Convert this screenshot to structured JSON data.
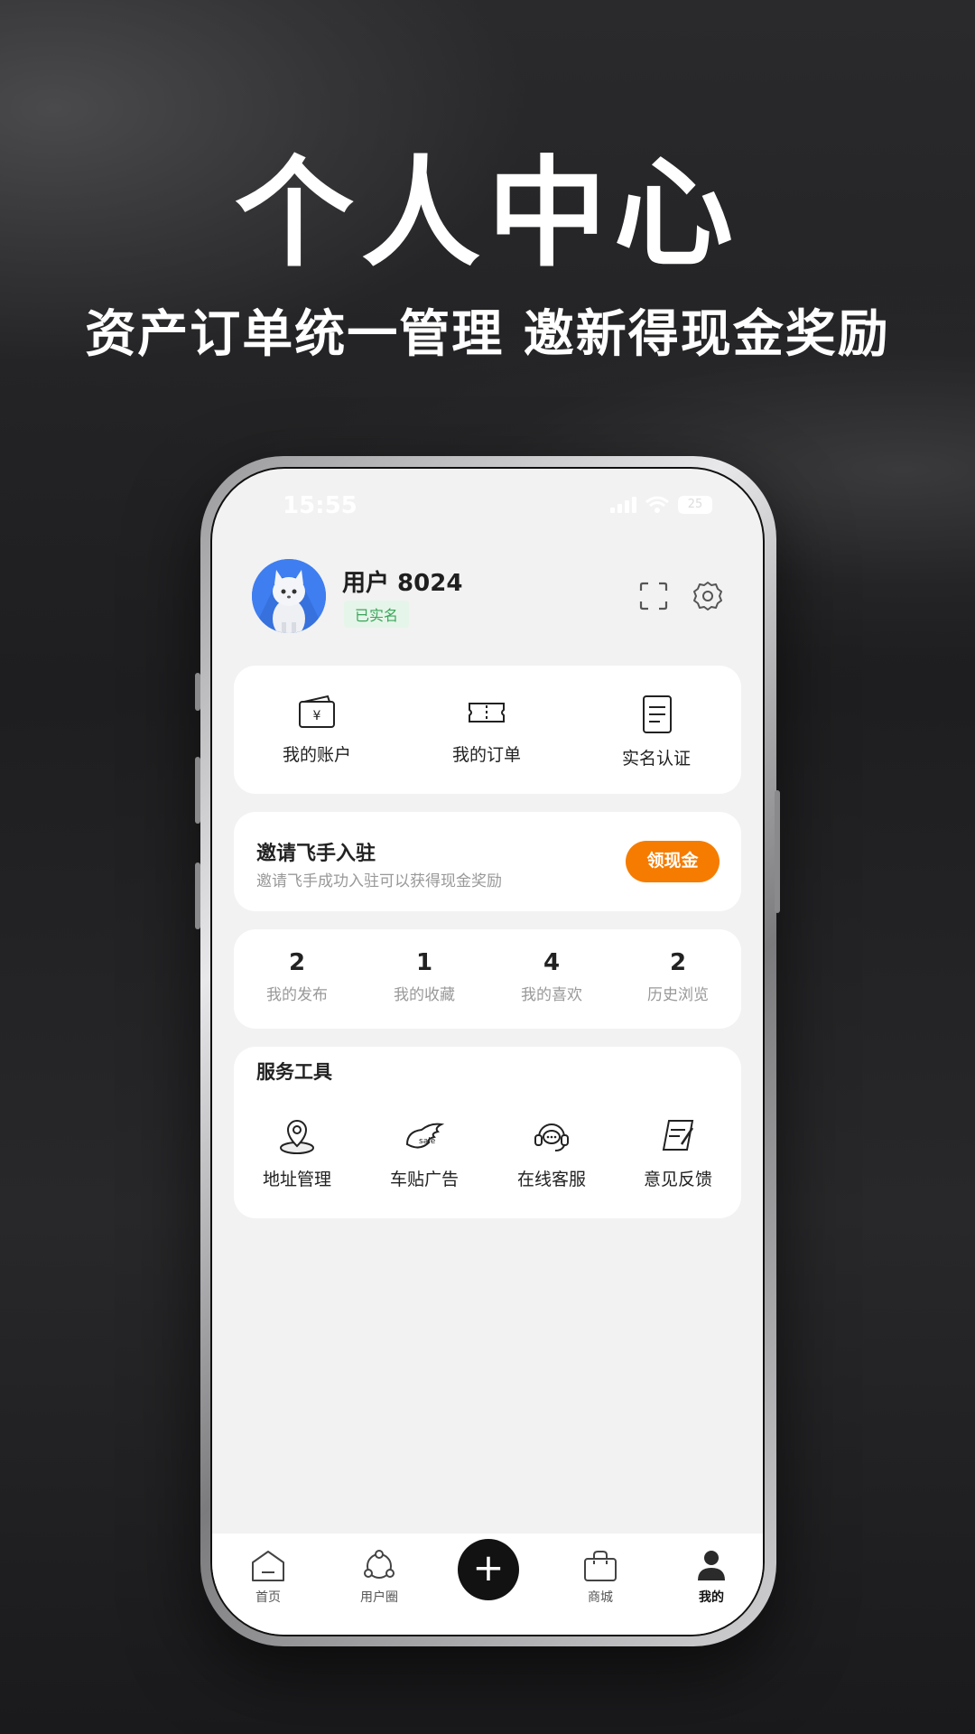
{
  "headline": "个人中心",
  "subheadline": "资产订单统一管理  邀新得现金奖励",
  "status_bar": {
    "time": "15:55",
    "battery": "25"
  },
  "profile": {
    "username": "用户 8024",
    "verified_badge": "已实名"
  },
  "quick_actions": [
    {
      "label": "我的账户",
      "icon": "wallet-icon"
    },
    {
      "label": "我的订单",
      "icon": "ticket-icon"
    },
    {
      "label": "实名认证",
      "icon": "document-icon"
    }
  ],
  "invite": {
    "title": "邀请飞手入驻",
    "description": "邀请飞手成功入驻可以获得现金奖励",
    "button": "领现金"
  },
  "stats": [
    {
      "value": "2",
      "label": "我的发布"
    },
    {
      "value": "1",
      "label": "我的收藏"
    },
    {
      "value": "4",
      "label": "我的喜欢"
    },
    {
      "value": "2",
      "label": "历史浏览"
    }
  ],
  "services": {
    "title": "服务工具",
    "items": [
      {
        "label": "地址管理",
        "icon": "location-pin-icon"
      },
      {
        "label": "车贴广告",
        "icon": "sale-tag-icon"
      },
      {
        "label": "在线客服",
        "icon": "headset-icon"
      },
      {
        "label": "意见反馈",
        "icon": "feedback-icon"
      }
    ]
  },
  "tabbar": [
    {
      "label": "首页",
      "icon": "home-icon"
    },
    {
      "label": "用户圈",
      "icon": "community-icon"
    },
    {
      "label": "+",
      "icon": "plus-icon"
    },
    {
      "label": "商城",
      "icon": "shop-bag-icon"
    },
    {
      "label": "我的",
      "icon": "user-icon",
      "active": true
    }
  ],
  "colors": {
    "accent": "#f57c00",
    "verified": "#3aa55a",
    "avatar_bg": "#3f7ef0"
  }
}
